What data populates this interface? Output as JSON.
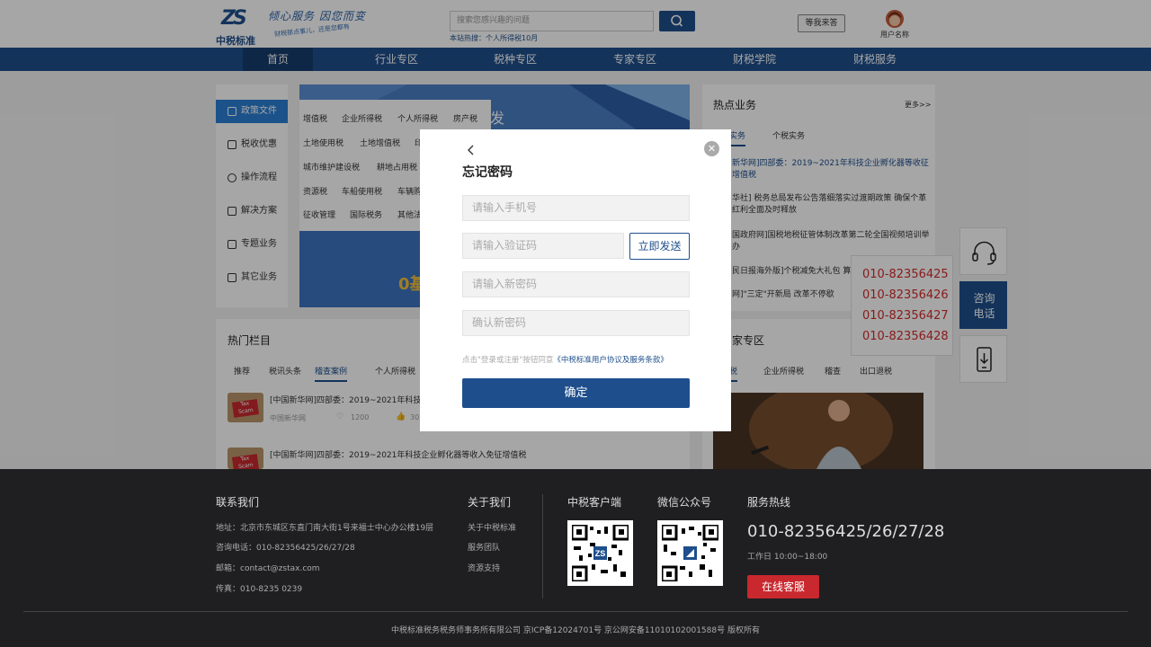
{
  "header": {
    "logo_text": "中税标准",
    "logo_mark": "ZS",
    "slogan": "倾心服务 因您而变",
    "slogan_sub": "财税那点事儿，还是您都有",
    "search_placeholder": "搜索您感兴趣的问题",
    "hot_search": "本站热搜：个人所得税10月",
    "wait_answer": "等我来答",
    "username": "用户名称"
  },
  "nav": {
    "items": [
      "首页",
      "行业专区",
      "税种专区",
      "专家专区",
      "财税学院",
      "财税服务"
    ],
    "active": "首页"
  },
  "sidebar": {
    "items": [
      "政策文件",
      "税收优惠",
      "操作流程",
      "解决方案",
      "专题业务",
      "其它业务"
    ]
  },
  "tax_menu": {
    "row1": [
      "增值税",
      "企业所得税",
      "个人所得税",
      "房产税"
    ],
    "row2": [
      "土地使用税",
      "土地增值税",
      "印"
    ],
    "row3": [
      "城市维护建设税",
      "耕地占用税"
    ],
    "row4": [
      "资源税",
      "车船使用税",
      "车辆购"
    ],
    "row5": [
      "征收管理",
      "国际税务",
      "其他法"
    ]
  },
  "banner": {
    "corner_text": "发",
    "promo_text": "0基"
  },
  "hot_columns": {
    "title": "热门栏目",
    "tabs": [
      "推荐",
      "税讯头条",
      "稽查案例",
      "个人所得税"
    ],
    "active_tab": "稽查案例",
    "news": [
      {
        "title": "[中国新华网]四部委：2019~2021年科技",
        "source": "中国新华网",
        "likes": "1200",
        "views": "30"
      },
      {
        "title": "[中国新华网]四部委：2019~2021年科技企业孵化器等收入免征增值税",
        "thumb": "Tax Scam"
      }
    ],
    "thumb_label_1": "Tax",
    "thumb_label_2": "Scam"
  },
  "hot_business": {
    "title": "热点业务",
    "more": "更多>>",
    "tabs": [
      "实务",
      "个税实务"
    ],
    "news": [
      "新华网]四部委：2019~2021年科技企业孵化器等收征增值税",
      "华社] 税务总局发布公告落细落实过渡期政策 确保个革红利全面及时释放",
      "国政府网]国税地税征管体制改革第二轮全国视频培训举办",
      "民日报海外版]个税减免大礼包 算",
      "网]\"三定\"开新局 改革不停歇"
    ]
  },
  "expert": {
    "title": "家专区",
    "tabs": [
      "税",
      "企业所得税",
      "稽查",
      "出口退税"
    ]
  },
  "float": {
    "phones": [
      "010-82356425",
      "010-82356426",
      "010-82356427",
      "010-82356428"
    ],
    "consult_line1": "咨询",
    "consult_line2": "电话"
  },
  "modal": {
    "title": "忘记密码",
    "phone_placeholder": "请输入手机号",
    "code_placeholder": "请输入验证码",
    "send_label": "立即发送",
    "new_pwd_placeholder": "请输入新密码",
    "confirm_pwd_placeholder": "确认新密码",
    "agree_prefix": "点击\"登录或注册\"按钮同意",
    "agree_link": "《中税标准用户协议及服务条款》",
    "submit_label": "确定"
  },
  "footer": {
    "contact_title": "联系我们",
    "address": "地址：北京市东城区东直门南大街1号来福士中心办公楼19层",
    "phone": "咨询电话：010-82356425/26/27/28",
    "email": "邮箱：contact@zstax.com",
    "fax": "传真：010-8235 0239",
    "about_title": "关于我们",
    "about_items": [
      "关于中税标准",
      "服务团队",
      "资源支持"
    ],
    "client_title": "中税客户端",
    "wechat_title": "微信公众号",
    "hotline_title": "服务热线",
    "hotline": "010-82356425/26/27/28",
    "hours": "工作日  10:00~18:00",
    "online_service": "在线客服",
    "copyright": "中税标准税务税务师事务所有限公司     京ICP备12024701号  京公网安备11010102001588号    版权所有"
  },
  "colors": {
    "brand": "#1e4f8c",
    "footer_bg": "#1f1f21",
    "accent_red": "#c8282e"
  }
}
